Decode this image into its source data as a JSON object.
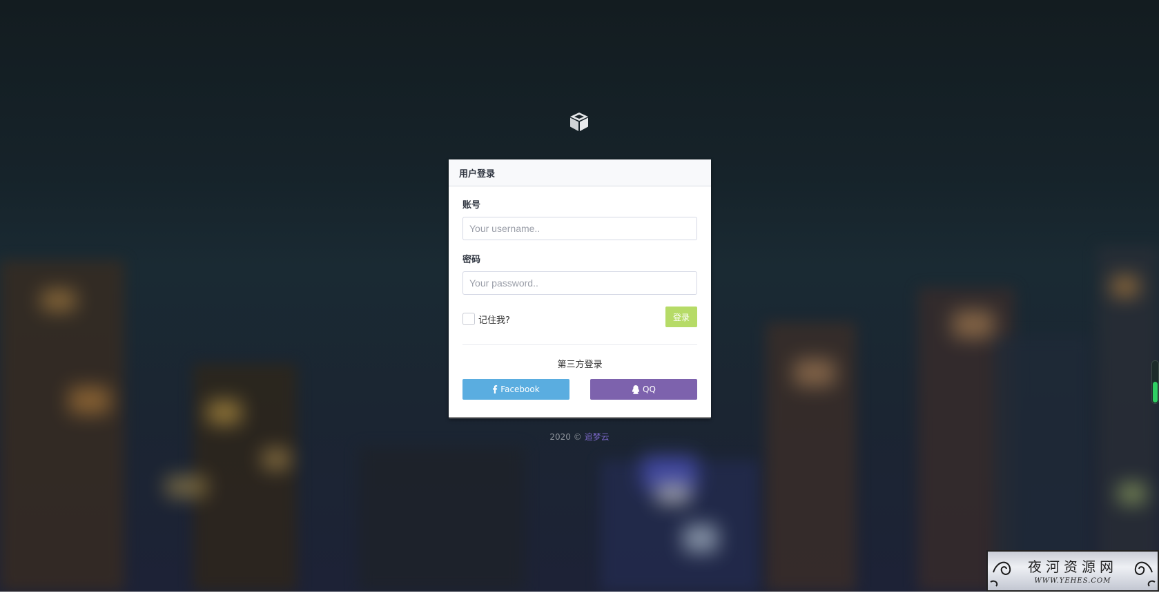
{
  "card": {
    "title": "用户登录"
  },
  "form": {
    "username_label": "账号",
    "username_placeholder": "Your username..",
    "username_value": "",
    "password_label": "密码",
    "password_placeholder": "Your password..",
    "password_value": "",
    "remember_label": "记住我?",
    "remember_checked": false,
    "login_button": "登录"
  },
  "third_party": {
    "title": "第三方登录",
    "facebook_label": "Facebook",
    "qq_label": "QQ"
  },
  "footer": {
    "copyright": "2020 © ",
    "link_text": "追梦云"
  },
  "icons": {
    "logo": "cube-icon",
    "facebook": "facebook-icon",
    "qq": "qq-penguin-icon"
  },
  "colors": {
    "login_button": "#b6db67",
    "facebook_button": "#5aade0",
    "qq_button": "#7d62ad",
    "footer_link": "#7a67c8",
    "scroll_thumb": "#2fcf63"
  },
  "watermark": {
    "title": "夜河资源网",
    "url": "WWW.YEHES.COM"
  }
}
